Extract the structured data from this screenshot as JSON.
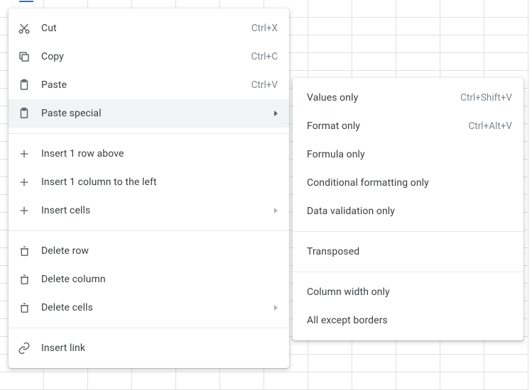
{
  "main_menu": {
    "cut": {
      "label": "Cut",
      "shortcut": "Ctrl+X"
    },
    "copy": {
      "label": "Copy",
      "shortcut": "Ctrl+C"
    },
    "paste": {
      "label": "Paste",
      "shortcut": "Ctrl+V"
    },
    "paste_special": {
      "label": "Paste special"
    },
    "insert_row": {
      "label": "Insert 1 row above"
    },
    "insert_col": {
      "label": "Insert 1 column to the left"
    },
    "insert_cells": {
      "label": "Insert cells"
    },
    "delete_row": {
      "label": "Delete row"
    },
    "delete_col": {
      "label": "Delete column"
    },
    "delete_cells": {
      "label": "Delete cells"
    },
    "insert_link": {
      "label": "Insert link"
    }
  },
  "paste_special_menu": {
    "values_only": {
      "label": "Values only",
      "shortcut": "Ctrl+Shift+V"
    },
    "format_only": {
      "label": "Format only",
      "shortcut": "Ctrl+Alt+V"
    },
    "formula_only": {
      "label": "Formula only"
    },
    "cond_fmt_only": {
      "label": "Conditional formatting only"
    },
    "data_val_only": {
      "label": "Data validation only"
    },
    "transposed": {
      "label": "Transposed"
    },
    "col_width_only": {
      "label": "Column width only"
    },
    "all_except_borders": {
      "label": "All except borders"
    }
  }
}
